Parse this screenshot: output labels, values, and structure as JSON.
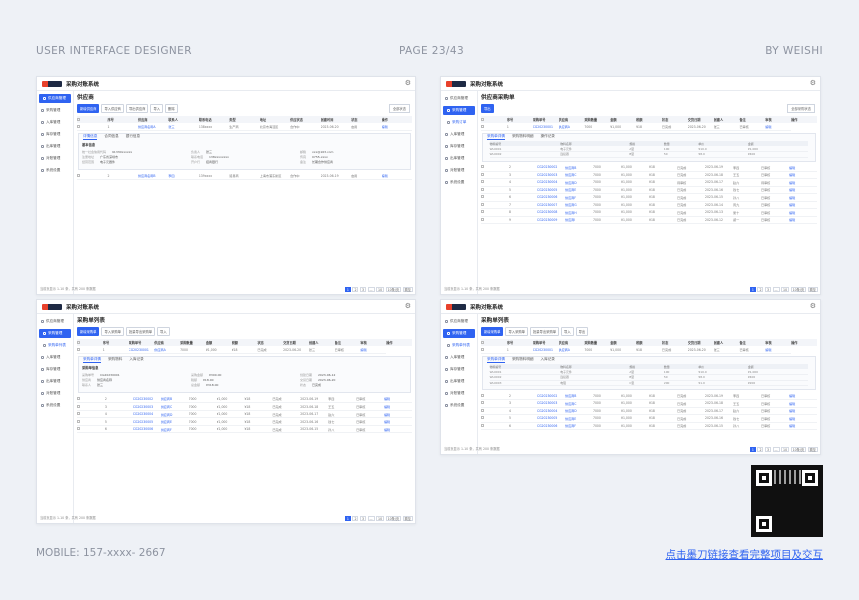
{
  "header": {
    "left": "USER INTERFACE DESIGNER",
    "center": "PAGE  23/43",
    "right": "BY WEISHI"
  },
  "footer": {
    "mobile": "MOBILE: 157-xxxx- 2667",
    "link": "点击墨刀链接查看完整项目及交互"
  },
  "colors": {
    "accent": "#2f63f1",
    "link": "#2f63f1",
    "bg": "#eef1f6"
  },
  "app": {
    "title": "采购对账系统",
    "gear_icon": "gear-icon"
  },
  "pages": [
    {
      "title": "供应商",
      "sidebar": [
        "供应商管理",
        "采购管理",
        "入库管理",
        "库存管理",
        "出库管理",
        "对账管理",
        "系统设置"
      ],
      "active": 0,
      "buttons": [
        "新增供应商",
        "导入供应商",
        "导出供应商",
        "导入",
        "删除"
      ],
      "select": "全部状态",
      "columns": [
        "",
        "序号",
        "供应商",
        "联系人",
        "联系电话",
        "类型",
        "地址",
        "供应状态",
        "创建时间",
        "状态",
        "操作"
      ],
      "rows": [
        [
          "",
          "1",
          "供应商名称A",
          "张三",
          "138xxxx",
          "生产商",
          "北京市海淀区",
          "合作中",
          "2023-06-20",
          "启用",
          "编辑"
        ]
      ],
      "tabs": [
        "详情信息",
        "合同信息",
        "银行信息"
      ],
      "detail_title": "基本信息",
      "detail": [
        [
          "统一社会信用代码",
          "91330xxxxxx"
        ],
        [
          "负责人",
          "张三"
        ],
        [
          "邮箱",
          "xxx@163.com"
        ],
        [
          "注册地址",
          "广东省深圳市"
        ],
        [
          "联系电话",
          "138xxxxxxxx"
        ],
        [
          "传真",
          "0755-xxxx"
        ],
        [
          "经营范围",
          "电子元器件"
        ],
        [
          "开户行",
          "招商银行"
        ],
        [
          "备注",
          "长期合作供应商"
        ]
      ],
      "rows_after": [
        [
          "",
          "2",
          "供应商名称B",
          "李四",
          "139xxxx",
          "贸易商",
          "上海市浦东新区",
          "合作中",
          "2023-06-19",
          "启用",
          "编辑"
        ]
      ],
      "total": "当前页显示 1-10 条，共有 200 条数据",
      "pages": [
        "1",
        "2",
        "3",
        "...",
        "10",
        "10条/页",
        "跳至"
      ]
    },
    {
      "title": "供应商采购单",
      "sidebar": [
        "供应商管理",
        "采购管理",
        "采购订单",
        "入库管理",
        "库存管理",
        "出库管理",
        "对账管理",
        "系统设置"
      ],
      "active": 1,
      "buttons": [
        "导出"
      ],
      "select": "全部采购状态",
      "columns": [
        "",
        "序号",
        "采购单号",
        "供应商",
        "采购数量",
        "金额",
        "税额",
        "状态",
        "交货日期",
        "创建人",
        "备注",
        "审核",
        "操作"
      ],
      "rows": [
        [
          "",
          "1",
          "CG20230001",
          "供应商A",
          "7000",
          "¥1,000",
          "¥18",
          "已完成",
          "2023-06-20",
          "张三",
          "已审核",
          "编辑"
        ]
      ],
      "tabs": [
        "采购单详情",
        "采购物料明细",
        "操作记录"
      ],
      "sub_columns": [
        "物料编号",
        "物料名称",
        "规格",
        "数量",
        "单价",
        "金额"
      ],
      "sub_rows": [
        [
          "WL0001",
          "电子元件",
          "A型",
          "100",
          "¥10.0",
          "¥1,000"
        ],
        [
          "WL0002",
          "连接器",
          "B型",
          "50",
          "¥8.0",
          "¥400"
        ]
      ],
      "rows_after": [
        [
          "",
          "2",
          "CG20230002",
          "供应商B",
          "7000",
          "¥1,000",
          "¥18",
          "已完成",
          "2023-06-19",
          "李四",
          "已审核",
          "编辑"
        ],
        [
          "",
          "3",
          "CG20230003",
          "供应商C",
          "7000",
          "¥1,000",
          "¥18",
          "已完成",
          "2023-06-18",
          "王五",
          "已审核",
          "编辑"
        ],
        [
          "",
          "4",
          "CG20230004",
          "供应商D",
          "7000",
          "¥1,000",
          "¥18",
          "待审核",
          "2023-06-17",
          "赵六",
          "待审核",
          "编辑"
        ],
        [
          "",
          "5",
          "CG20230005",
          "供应商E",
          "7000",
          "¥1,000",
          "¥18",
          "已完成",
          "2023-06-16",
          "钱七",
          "已审核",
          "编辑"
        ],
        [
          "",
          "6",
          "CG20230006",
          "供应商F",
          "7000",
          "¥1,000",
          "¥18",
          "已完成",
          "2023-06-15",
          "孙八",
          "已审核",
          "编辑"
        ],
        [
          "",
          "7",
          "CG20230007",
          "供应商G",
          "7000",
          "¥1,000",
          "¥18",
          "已完成",
          "2023-06-14",
          "周九",
          "已审核",
          "编辑"
        ],
        [
          "",
          "8",
          "CG20230008",
          "供应商H",
          "7000",
          "¥1,000",
          "¥18",
          "已完成",
          "2023-06-13",
          "吴十",
          "已审核",
          "编辑"
        ],
        [
          "",
          "9",
          "CG20230009",
          "供应商I",
          "7000",
          "¥1,000",
          "¥18",
          "已完成",
          "2023-06-12",
          "郑一",
          "已审核",
          "编辑"
        ]
      ],
      "total": "当前页显示 1-10 条，共有 200 条数据",
      "pages": [
        "1",
        "2",
        "3",
        "...",
        "10",
        "10条/页",
        "跳至"
      ]
    },
    {
      "title": "采购单列表",
      "sidebar": [
        "供应商管理",
        "采购管理",
        "采购单列表",
        "入库管理",
        "库存管理",
        "出库管理",
        "对账管理",
        "系统设置"
      ],
      "active": 1,
      "buttons": [
        "新增采购单",
        "导入采购单",
        "批量导出采购单",
        "导入"
      ],
      "select": "",
      "columns": [
        "",
        "序号",
        "采购单号",
        "供应商",
        "采购数量",
        "金额",
        "税额",
        "状态",
        "交货日期",
        "创建人",
        "备注",
        "审核",
        "操作"
      ],
      "rows": [
        [
          "",
          "1",
          "CG20230001",
          "供应商A",
          "7000",
          "¥1,000",
          "¥18",
          "已完成",
          "2023-06-20",
          "张三",
          "已审核",
          "编辑"
        ]
      ],
      "tabs": [
        "采购单详情",
        "采购物料",
        "入库记录"
      ],
      "detail_title": "采购单信息",
      "detail": [
        [
          "采购单号",
          "CG20230001"
        ],
        [
          "采购金额",
          "¥300.00"
        ],
        [
          "创建日期",
          "2023-06-12"
        ],
        [
          "供应商",
          "供应商名称"
        ],
        [
          "税额",
          "¥18.00"
        ],
        [
          "交货日期",
          "2023-06-20"
        ],
        [
          "联系人",
          "张三"
        ],
        [
          "总金额",
          "¥318.00"
        ],
        [
          "状态",
          "已完成"
        ]
      ],
      "rows_after": [
        [
          "",
          "2",
          "CG20230002",
          "供应商B",
          "7000",
          "¥1,000",
          "¥18",
          "已完成",
          "2023-06-19",
          "李四",
          "已审核",
          "编辑"
        ],
        [
          "",
          "3",
          "CG20230003",
          "供应商C",
          "7000",
          "¥1,000",
          "¥18",
          "已完成",
          "2023-06-18",
          "王五",
          "已审核",
          "编辑"
        ],
        [
          "",
          "4",
          "CG20230004",
          "供应商D",
          "7000",
          "¥1,000",
          "¥18",
          "已完成",
          "2023-06-17",
          "赵六",
          "已审核",
          "编辑"
        ],
        [
          "",
          "5",
          "CG20230005",
          "供应商E",
          "7000",
          "¥1,000",
          "¥18",
          "已完成",
          "2023-06-16",
          "钱七",
          "已审核",
          "编辑"
        ],
        [
          "",
          "6",
          "CG20230006",
          "供应商F",
          "7000",
          "¥1,000",
          "¥18",
          "已完成",
          "2023-06-15",
          "孙八",
          "已审核",
          "编辑"
        ]
      ],
      "total": "当前页显示 1-10 条，共有 200 条数据",
      "pages": [
        "1",
        "2",
        "3",
        "...",
        "10",
        "10条/页",
        "跳至"
      ]
    },
    {
      "title": "采购单列表",
      "sidebar": [
        "供应商管理",
        "采购管理",
        "采购单列表",
        "入库管理",
        "库存管理",
        "出库管理",
        "对账管理",
        "系统设置"
      ],
      "active": 1,
      "buttons": [
        "新增采购单",
        "导入采购单",
        "批量导出采购单",
        "导入",
        "导出"
      ],
      "select": "",
      "columns": [
        "",
        "序号",
        "采购单号",
        "供应商",
        "采购数量",
        "金额",
        "税额",
        "状态",
        "交货日期",
        "创建人",
        "备注",
        "审核",
        "操作"
      ],
      "rows": [
        [
          "",
          "1",
          "CG20230001",
          "供应商A",
          "7000",
          "¥1,000",
          "¥18",
          "已完成",
          "2023-06-20",
          "张三",
          "已审核",
          "编辑"
        ]
      ],
      "tabs": [
        "采购单详情",
        "采购物料明细",
        "入库记录"
      ],
      "sub_columns": [
        "物料编号",
        "物料名称",
        "规格",
        "数量",
        "单价",
        "金额"
      ],
      "sub_rows": [
        [
          "WL0001",
          "电子元件",
          "A型",
          "100",
          "¥10.0",
          "¥1,000"
        ],
        [
          "WL0002",
          "连接器",
          "B型",
          "50",
          "¥8.0",
          "¥400"
        ],
        [
          "WL0003",
          "电阻",
          "C型",
          "200",
          "¥1.0",
          "¥200"
        ]
      ],
      "rows_after": [
        [
          "",
          "2",
          "CG20230002",
          "供应商B",
          "7000",
          "¥1,000",
          "¥18",
          "已完成",
          "2023-06-19",
          "李四",
          "已审核",
          "编辑"
        ],
        [
          "",
          "3",
          "CG20230003",
          "供应商C",
          "7000",
          "¥1,000",
          "¥18",
          "已完成",
          "2023-06-18",
          "王五",
          "已审核",
          "编辑"
        ],
        [
          "",
          "4",
          "CG20230004",
          "供应商D",
          "7000",
          "¥1,000",
          "¥18",
          "已完成",
          "2023-06-17",
          "赵六",
          "已审核",
          "编辑"
        ],
        [
          "",
          "5",
          "CG20230005",
          "供应商E",
          "7000",
          "¥1,000",
          "¥18",
          "已完成",
          "2023-06-16",
          "钱七",
          "已审核",
          "编辑"
        ],
        [
          "",
          "6",
          "CG20230006",
          "供应商F",
          "7000",
          "¥1,000",
          "¥18",
          "已完成",
          "2023-06-15",
          "孙八",
          "已审核",
          "编辑"
        ]
      ],
      "total": "当前页显示 1-10 条，共有 200 条数据",
      "pages": [
        "1",
        "2",
        "3",
        "...",
        "10",
        "10条/页",
        "跳至"
      ]
    }
  ]
}
